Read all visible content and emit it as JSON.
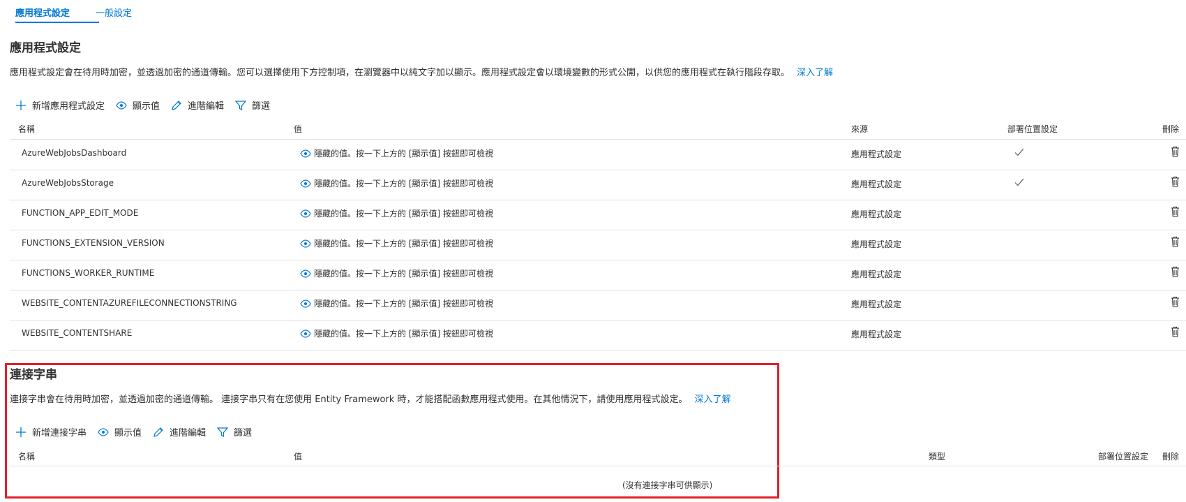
{
  "tabs": [
    {
      "label": "應用程式設定",
      "active": true
    },
    {
      "label": "一般設定",
      "active": false
    }
  ],
  "app_settings": {
    "title": "應用程式設定",
    "description": "應用程式設定會在待用時加密，並透過加密的通道傳輸。您可以選擇使用下方控制項，在瀏覽器中以純文字加以顯示。應用程式設定會以環境變數的形式公開，以供您的應用程式在執行階段存取。",
    "learn_more": "深入了解",
    "toolbar": {
      "add": "新增應用程式設定",
      "show_values": "顯示值",
      "advanced_edit": "進階編輯",
      "filter": "篩選"
    },
    "columns": {
      "name": "名稱",
      "value": "值",
      "source": "來源",
      "slot": "部署位置設定",
      "delete": "刪除"
    },
    "rows": [
      {
        "name": "AzureWebJobsDashboard",
        "value": "隱藏的值。按一下上方的 [顯示值] 按鈕即可檢視",
        "source": "應用程式設定",
        "slot_setting": true
      },
      {
        "name": "AzureWebJobsStorage",
        "value": "隱藏的值。按一下上方的 [顯示值] 按鈕即可檢視",
        "source": "應用程式設定",
        "slot_setting": true
      },
      {
        "name": "FUNCTION_APP_EDIT_MODE",
        "value": "隱藏的值。按一下上方的 [顯示值] 按鈕即可檢視",
        "source": "應用程式設定",
        "slot_setting": false
      },
      {
        "name": "FUNCTIONS_EXTENSION_VERSION",
        "value": "隱藏的值。按一下上方的 [顯示值] 按鈕即可檢視",
        "source": "應用程式設定",
        "slot_setting": false
      },
      {
        "name": "FUNCTIONS_WORKER_RUNTIME",
        "value": "隱藏的值。按一下上方的 [顯示值] 按鈕即可檢視",
        "source": "應用程式設定",
        "slot_setting": false
      },
      {
        "name": "WEBSITE_CONTENTAZUREFILECONNECTIONSTRING",
        "value": "隱藏的值。按一下上方的 [顯示值] 按鈕即可檢視",
        "source": "應用程式設定",
        "slot_setting": false
      },
      {
        "name": "WEBSITE_CONTENTSHARE",
        "value": "隱藏的值。按一下上方的 [顯示值] 按鈕即可檢視",
        "source": "應用程式設定",
        "slot_setting": false
      }
    ]
  },
  "connection_strings": {
    "title": "連接字串",
    "description": "連接字串會在待用時加密，並透過加密的通道傳輸。 連接字串只有在您使用 Entity Framework 時，才能搭配函數應用程式使用。在其他情況下，請使用應用程式設定。",
    "learn_more": "深入了解",
    "toolbar": {
      "add": "新增連接字串",
      "show_values": "顯示值",
      "advanced_edit": "進階編輯",
      "filter": "篩選"
    },
    "columns": {
      "name": "名稱",
      "value": "值",
      "type": "類型",
      "slot": "部署位置設定",
      "delete": "刪除"
    },
    "empty_message": "(沒有連接字串可供顯示)"
  },
  "colors": {
    "accent": "#0078d4",
    "highlight_border": "#e21f26"
  }
}
